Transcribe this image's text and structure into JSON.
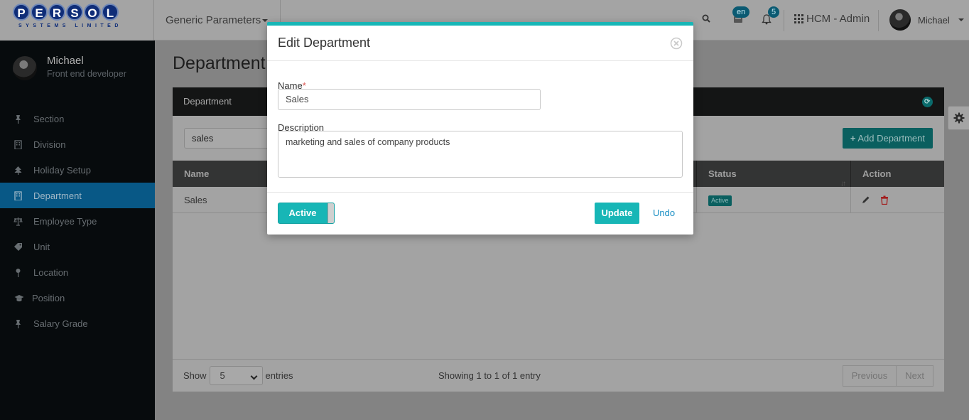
{
  "brand": {
    "logo_letters": [
      "P",
      "E",
      "R",
      "S",
      "O",
      "L"
    ],
    "logo_sub": "SYSTEMS LIMITED"
  },
  "topbar": {
    "menu_label": "Generic Parameters",
    "lang_badge": "en",
    "notifications_count": "5",
    "app_label": "HCM - Admin",
    "user_name": "Michael"
  },
  "sidebar": {
    "user_name": "Michael",
    "user_role": "Front end developer",
    "items": [
      {
        "label": "Section",
        "icon": "pin-icon"
      },
      {
        "label": "Division",
        "icon": "building-icon"
      },
      {
        "label": "Holiday Setup",
        "icon": "tree-icon"
      },
      {
        "label": "Department",
        "icon": "building-icon",
        "active": true
      },
      {
        "label": "Employee Type",
        "icon": "scale-icon"
      },
      {
        "label": "Unit",
        "icon": "tag-icon"
      },
      {
        "label": "Location",
        "icon": "map-pin-icon"
      },
      {
        "label": "Position",
        "icon": "graduation-cap-icon"
      },
      {
        "label": "Salary Grade",
        "icon": "pin-icon"
      }
    ]
  },
  "main": {
    "page_title": "Department",
    "panel_title": "Department",
    "filter_value": "sales",
    "add_button": "Add Department",
    "table": {
      "columns": [
        "Name",
        "Status",
        "Action"
      ],
      "rows": [
        {
          "name": "Sales",
          "status": "Active"
        }
      ]
    },
    "footer": {
      "show_label": "Show",
      "show_value": "5",
      "entries_label": "entries",
      "showing_text": "Showing 1 to 1 of 1 entry",
      "previous": "Previous",
      "next": "Next"
    }
  },
  "modal": {
    "title": "Edit Department",
    "name_label": "Name",
    "required_mark": "*",
    "name_value": "Sales",
    "description_label": "Description",
    "description_value": "marketing and sales of company products",
    "toggle_label": "Active",
    "update_button": "Update",
    "undo_link": "Undo"
  },
  "colors": {
    "accent_teal": "#17b6b6",
    "sidebar_active": "#085886",
    "link_blue": "#1a8fc4"
  }
}
